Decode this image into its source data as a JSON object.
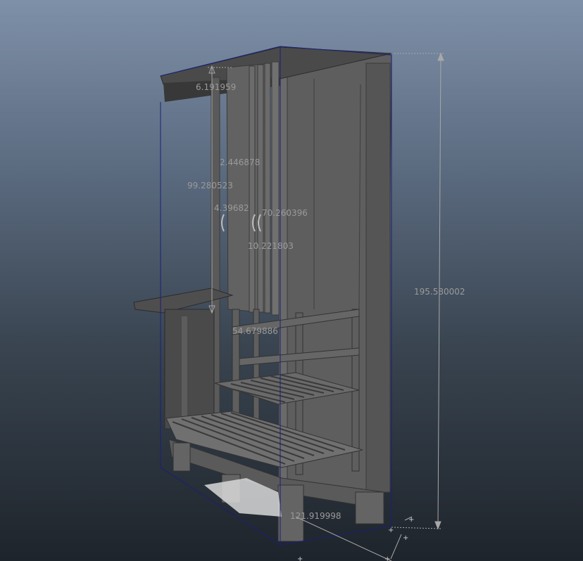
{
  "viewport": {
    "colors": {
      "bg_top": "#7e90a8",
      "bg_bottom": "#1e242b",
      "model_fill": "#5e5e5e",
      "model_dark": "#3f3f3f",
      "model_light": "#777777",
      "bbox_line": "#1b1f7a",
      "dim_line": "#a8a8a8",
      "dim_text": "#9a9a9a"
    },
    "dimensions": [
      {
        "id": "height-total",
        "text": "195.580002"
      },
      {
        "id": "depth-base",
        "text": "121.919998"
      },
      {
        "id": "top-gap",
        "text": "6.191959"
      },
      {
        "id": "door-width",
        "text": "2.446878"
      },
      {
        "id": "panel-height",
        "text": "99.280523"
      },
      {
        "id": "handle-offset",
        "text": "4.39682"
      },
      {
        "id": "door-height",
        "text": "70.260396"
      },
      {
        "id": "handle-size",
        "text": "10.221803"
      },
      {
        "id": "shelf-height",
        "text": "54.679886"
      }
    ]
  }
}
